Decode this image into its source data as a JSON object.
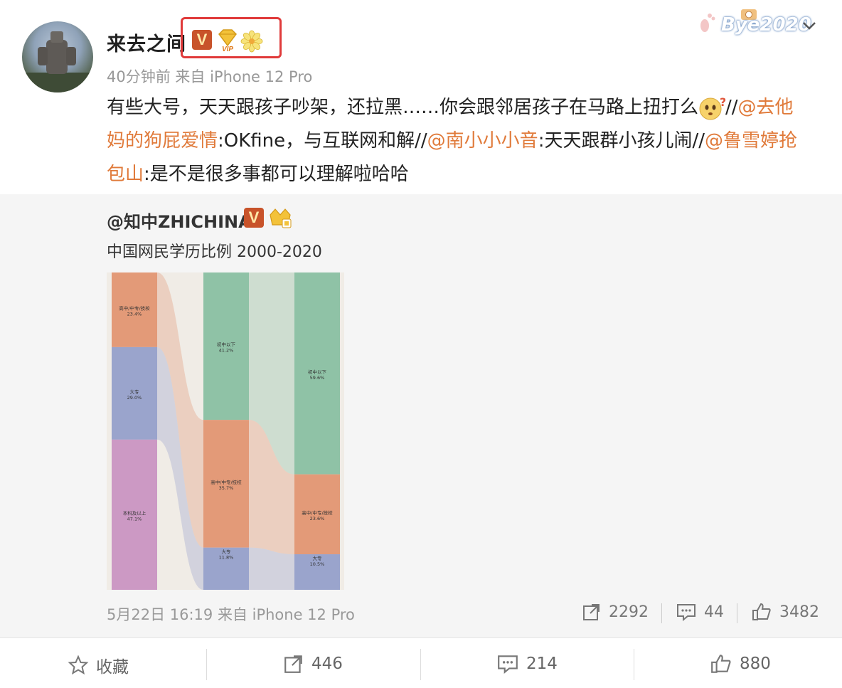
{
  "post": {
    "username": "来去之间",
    "badge_v": "V",
    "badge_vip": "VIP",
    "meta": "40分钟前 来自 iPhone 12 Pro",
    "watermark": "Bye2020",
    "text_segments": [
      {
        "type": "text",
        "value": "有些大号，天天跟孩子吵架，还拉黑……你会跟邻居孩子在马路上扭打么"
      },
      {
        "type": "emoji",
        "value": "thinking-face-emoji"
      },
      {
        "type": "text",
        "value": "//"
      },
      {
        "type": "mention",
        "value": "@去他妈的狗屁爱情"
      },
      {
        "type": "text",
        "value": ":OKfine，与互联网和解//"
      },
      {
        "type": "mention",
        "value": "@南小小小音"
      },
      {
        "type": "text",
        "value": ":天天跟群小孩儿闹//"
      },
      {
        "type": "mention",
        "value": "@鲁雪婷抢包山"
      },
      {
        "type": "text",
        "value": ":是不是很多事都可以理解啦哈哈"
      }
    ]
  },
  "repost": {
    "user": "@知中ZHICHINA",
    "badge_v": "V",
    "title": "中国网民学历比例 2000-2020",
    "footer": "5月22日 16:19 来自 iPhone 12 Pro",
    "share_count": "2292",
    "comment_count": "44",
    "like_count": "3482"
  },
  "chart_data": {
    "type": "bar",
    "columns": [
      {
        "segments": [
          {
            "label": "高中/中专/技校",
            "value": "23.4%",
            "color": "#e39a78"
          },
          {
            "label": "大专",
            "value": "29.0%",
            "color": "#9aa4cc"
          },
          {
            "label": "本科及以上",
            "value": "47.1%",
            "color": "#cc99c4"
          }
        ]
      },
      {
        "segments": [
          {
            "label": "初中以下",
            "value": "41.2%",
            "color": "#8fc2a6"
          },
          {
            "label": "高中/中专/技校",
            "value": "35.7%",
            "color": "#e39a78"
          },
          {
            "label": "大专",
            "value": "11.8%",
            "color": "#9aa4cc"
          }
        ]
      },
      {
        "segments": [
          {
            "label": "初中以下",
            "value": "59.6%",
            "color": "#8fc2a6"
          },
          {
            "label": "高中/中专/技校",
            "value": "23.6%",
            "color": "#e39a78"
          },
          {
            "label": "大专",
            "value": "10.5%",
            "color": "#9aa4cc"
          }
        ]
      }
    ]
  },
  "bottom_bar": {
    "favorite_label": "收藏",
    "share_count": "446",
    "comment_count": "214",
    "like_count": "880"
  },
  "colors": {
    "mention": "#e07a3a",
    "vip_badge": "#c8532a",
    "highlight_box": "#e03a3a"
  }
}
